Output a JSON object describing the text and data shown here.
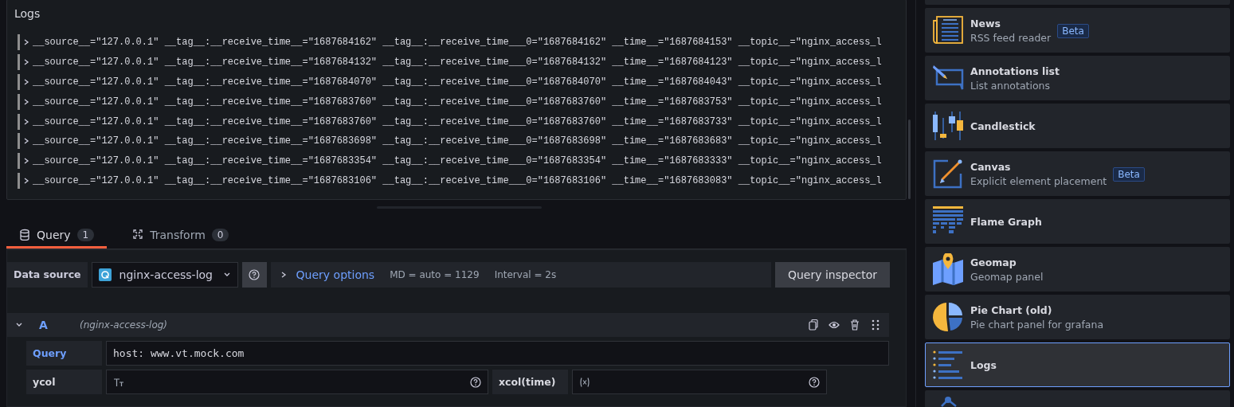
{
  "logs_panel": {
    "title": "Logs",
    "rows": [
      {
        "text": "__source__=\"127.0.0.1\" __tag__:__receive_time__=\"1687684162\" __tag__:__receive_time___0=\"1687684162\" __time__=\"1687684153\" __topic__=\"nginx_access_l"
      },
      {
        "text": "__source__=\"127.0.0.1\" __tag__:__receive_time__=\"1687684132\" __tag__:__receive_time___0=\"1687684132\" __time__=\"1687684123\" __topic__=\"nginx_access_l"
      },
      {
        "text": "__source__=\"127.0.0.1\" __tag__:__receive_time__=\"1687684070\" __tag__:__receive_time___0=\"1687684070\" __time__=\"1687684043\" __topic__=\"nginx_access_l"
      },
      {
        "text": "__source__=\"127.0.0.1\" __tag__:__receive_time__=\"1687683760\" __tag__:__receive_time___0=\"1687683760\" __time__=\"1687683753\" __topic__=\"nginx_access_l"
      },
      {
        "text": "__source__=\"127.0.0.1\" __tag__:__receive_time__=\"1687683760\" __tag__:__receive_time___0=\"1687683760\" __time__=\"1687683733\" __topic__=\"nginx_access_l"
      },
      {
        "text": "__source__=\"127.0.0.1\" __tag__:__receive_time__=\"1687683698\" __tag__:__receive_time___0=\"1687683698\" __time__=\"1687683683\" __topic__=\"nginx_access_l"
      },
      {
        "text": "__source__=\"127.0.0.1\" __tag__:__receive_time__=\"1687683354\" __tag__:__receive_time___0=\"1687683354\" __time__=\"1687683333\" __topic__=\"nginx_access_l"
      },
      {
        "text": "__source__=\"127.0.0.1\" __tag__:__receive_time__=\"1687683106\" __tag__:__receive_time___0=\"1687683106\" __time__=\"1687683083\" __topic__=\"nginx_access_l"
      }
    ]
  },
  "editor_tabs": [
    {
      "label": "Query",
      "count": "1",
      "selected": true,
      "kind": "query"
    },
    {
      "label": "Transform",
      "count": "0",
      "selected": false,
      "kind": "transform"
    }
  ],
  "data_source": {
    "label": "Data source",
    "value": "nginx-access-log"
  },
  "query_options": {
    "label": "Query options",
    "max_data_points": "MD = auto = 1129",
    "interval": "Interval = 2s"
  },
  "query_inspector_button": "Query inspector",
  "query_row": {
    "ref_id": "A",
    "datasource": "(nginx-access-log)",
    "expanded": true,
    "field_rows": [
      {
        "fields": [
          {
            "label": "Query",
            "value": "host: www.vt.mock.com",
            "kind": "code",
            "active": true
          }
        ]
      },
      {
        "fields": [
          {
            "label": "ycol",
            "kind": "text",
            "active": false
          },
          {
            "label": "xcol(time)",
            "kind": "variable",
            "active": false
          }
        ]
      }
    ]
  },
  "visualizations": [
    {
      "kind": "blank",
      "selected": false
    },
    {
      "kind": "news",
      "title": "News",
      "description": "RSS feed reader",
      "badge": "Beta",
      "selected": false
    },
    {
      "kind": "annotations",
      "title": "Annotations list",
      "description": "List annotations",
      "selected": false
    },
    {
      "kind": "candlestick",
      "title": "Candlestick",
      "selected": false
    },
    {
      "kind": "canvas",
      "title": "Canvas",
      "description": "Explicit element placement",
      "badge": "Beta",
      "selected": false
    },
    {
      "kind": "flame",
      "title": "Flame Graph",
      "selected": false
    },
    {
      "kind": "geomap",
      "title": "Geomap",
      "description": "Geomap panel",
      "selected": false
    },
    {
      "kind": "pie",
      "title": "Pie Chart (old)",
      "description": "Pie chart panel for grafana",
      "selected": false
    },
    {
      "kind": "logs",
      "title": "Logs",
      "selected": true
    },
    {
      "kind": "node-graph",
      "selected": false
    }
  ]
}
